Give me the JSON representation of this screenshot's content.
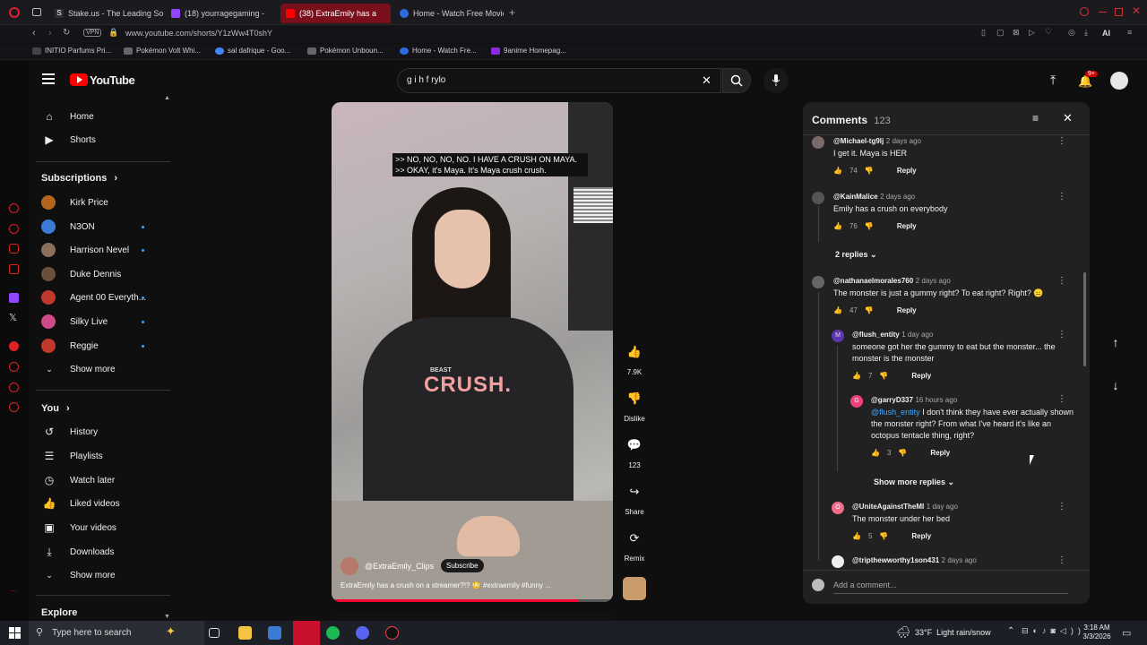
{
  "browser": {
    "tabs": [
      {
        "label": "Stake.us - The Leading So",
        "active": false,
        "icon_color": "#2b2f38"
      },
      {
        "label": "(18) yourragegaming -",
        "active": false,
        "icon_color": "#9146ff"
      },
      {
        "label": "(38) ExtraEmily has a",
        "active": true,
        "icon_color": "#ff0000"
      },
      {
        "label": "Home - Watch Free Movie",
        "active": false,
        "icon_color": "#2d6cdf"
      }
    ],
    "vpn": "VPN",
    "url": "www.youtube.com/shorts/Y1zWw4T0shY",
    "ai_label": "AI",
    "notification_badge": "9+",
    "bookmarks": [
      {
        "label": "INITIO Parfums Pri...",
        "icon_color": "#444"
      },
      {
        "label": "Pokémon Volt Whi...",
        "icon_color": "#666"
      },
      {
        "label": "sal dafrique - Goo...",
        "icon_color": "#4285f4"
      },
      {
        "label": "Pokémon Unboun...",
        "icon_color": "#666"
      },
      {
        "label": "Home - Watch Fre...",
        "icon_color": "#2d6cdf"
      },
      {
        "label": "9anime Homepag...",
        "icon_color": "#8a2be2"
      }
    ]
  },
  "youtube": {
    "logo_text": "YouTube",
    "search_value": "g i h f rylo",
    "sidebar": {
      "main": [
        {
          "label": "Home",
          "icon": "home-icon"
        },
        {
          "label": "Shorts",
          "icon": "shorts-icon"
        }
      ],
      "subscriptions_title": "Subscriptions",
      "subscriptions": [
        {
          "label": "Kirk Price",
          "color": "#b5651d",
          "dot": false
        },
        {
          "label": "N3ON",
          "color": "#3a7bd5",
          "dot": true
        },
        {
          "label": "Harrison Nevel",
          "color": "#8b6f5a",
          "dot": true
        },
        {
          "label": "Duke Dennis",
          "color": "#6b4f3a",
          "dot": false
        },
        {
          "label": "Agent 00 Everyth...",
          "color": "#c0392b",
          "dot": true
        },
        {
          "label": "Silky Live",
          "color": "#d04a8a",
          "dot": true
        },
        {
          "label": "Reggie",
          "color": "#c0392b",
          "dot": true
        }
      ],
      "show_more_1": "Show more",
      "you_title": "You",
      "you_items": [
        {
          "label": "History",
          "icon": "history-icon"
        },
        {
          "label": "Playlists",
          "icon": "playlists-icon"
        },
        {
          "label": "Watch later",
          "icon": "watch-later-icon"
        },
        {
          "label": "Liked videos",
          "icon": "liked-videos-icon"
        },
        {
          "label": "Your videos",
          "icon": "your-videos-icon"
        },
        {
          "label": "Downloads",
          "icon": "downloads-icon"
        }
      ],
      "show_more_2": "Show more",
      "explore_title": "Explore"
    },
    "video": {
      "caption_line1": ">> NO, NO, NO, NO. I HAVE A CRUSH ON MAYA.",
      "caption_line2": ">> OKAY, it's Maya. It's Maya crush crush.",
      "shirt_text": "CRUSH.",
      "shirt_small": "BEAST",
      "channel": "@ExtraEmily_Clips",
      "subscribe": "Subscribe",
      "title": "ExtraEmily has a crush on a streamer?!? 😳 #extraemily #funny ..."
    },
    "actions": {
      "likes": "7.9K",
      "dislike": "Dislike",
      "comments": "123",
      "share": "Share",
      "remix": "Remix"
    },
    "comments_panel": {
      "title": "Comments",
      "count": "123",
      "add_placeholder": "Add a comment...",
      "reply_label": "Reply",
      "replies_toggle": "2 replies",
      "show_more_replies": "Show more replies",
      "items": [
        {
          "user": "@Michael-tg9lj",
          "time": "2 days ago",
          "text": "I get it. Maya is HER",
          "likes": "74",
          "avatar_color": "#7a6a6a"
        },
        {
          "user": "@KainMalice",
          "time": "2 days ago",
          "text": "Emily has a crush on everybody",
          "likes": "76",
          "avatar_color": "#555"
        },
        {
          "user": "@nathanaelmorales760",
          "time": "2 days ago",
          "text": "The monster is just a gummy right? To eat right? Right? 😑",
          "likes": "47",
          "avatar_color": "#666"
        },
        {
          "user": "@flush_entity",
          "time": "1 day ago",
          "text": "someone got her the gummy to eat but the monster... the monster is the monster",
          "likes": "7",
          "avatar_color": "#5e35b1",
          "avatar_letter": "M"
        },
        {
          "user": "@garryD337",
          "time": "16 hours ago",
          "mention": "@flush_entity",
          "text": "I don't think they have ever actually shown the monster right? From what I've heard it's like an octopus tentacle thing, right?",
          "likes": "3",
          "avatar_color": "#ec407a",
          "avatar_letter": "G"
        },
        {
          "user": "@UniteAgainstTheMI",
          "time": "1 day ago",
          "text": "The monster under her bed",
          "likes": "5",
          "avatar_color": "#ef6c8a",
          "avatar_letter": "O"
        },
        {
          "user": "@tripthewworthy1son431",
          "time": "2 days ago",
          "text": "",
          "likes": "",
          "avatar_color": "#eee"
        }
      ]
    }
  },
  "taskbar": {
    "search_placeholder": "Type here to search",
    "weather": "33°F  Light rain/snow",
    "time": "3:18 AM",
    "date": "3/3/2026"
  }
}
